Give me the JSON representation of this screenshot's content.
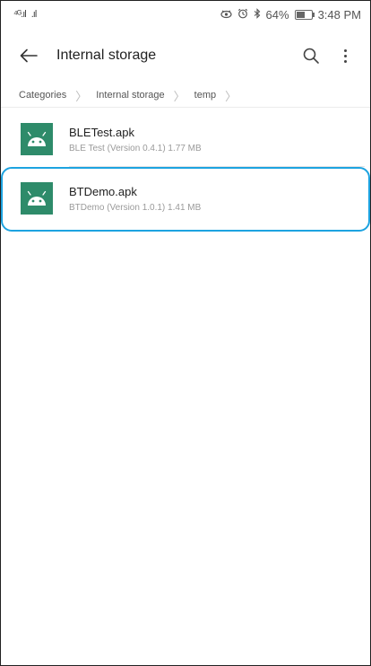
{
  "status_bar": {
    "left_signal_1": "⁴ᴳ.ıl",
    "left_signal_2": ".ıl",
    "battery_percent": "64%",
    "battery_level": 0.64,
    "time": "3:48 PM"
  },
  "app_bar": {
    "title": "Internal storage"
  },
  "breadcrumb": {
    "items": [
      "Categories",
      "Internal storage",
      "temp"
    ]
  },
  "files": [
    {
      "name": "BLETest.apk",
      "meta": "BLE Test (Version 0.4.1) 1.77 MB",
      "highlighted": false
    },
    {
      "name": "BTDemo.apk",
      "meta": "BTDemo (Version 1.0.1) 1.41 MB",
      "highlighted": true
    }
  ],
  "colors": {
    "accent_highlight": "#1da3e0",
    "apk_icon_bg": "#2e8b6a"
  }
}
